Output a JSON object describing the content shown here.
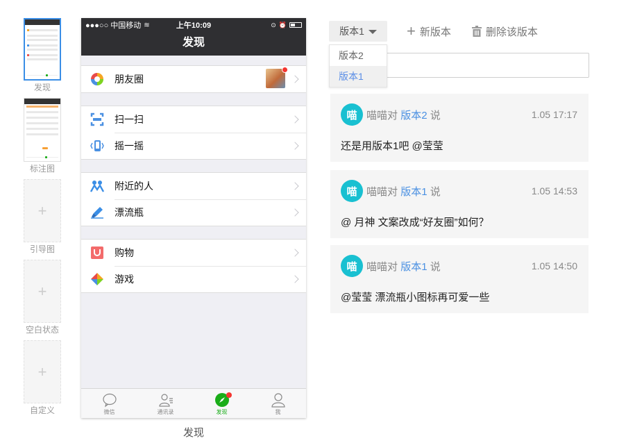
{
  "thumbnails": [
    {
      "caption": "发现",
      "active": true
    },
    {
      "caption": "标注图",
      "active": false
    },
    {
      "caption": "引导图",
      "plus": "+"
    },
    {
      "caption": "空白状态",
      "plus": "+"
    },
    {
      "caption": "自定义",
      "plus": "+"
    }
  ],
  "phone": {
    "status": {
      "carrier": "●●●○○ 中国移动",
      "time": "上午10:09"
    },
    "title": "发现",
    "groups": [
      [
        {
          "label": "朋友圈",
          "icon": "moments-icon"
        }
      ],
      [
        {
          "label": "扫一扫",
          "icon": "scan-icon"
        },
        {
          "label": "摇一摇",
          "icon": "shake-icon"
        }
      ],
      [
        {
          "label": "附近的人",
          "icon": "nearby-people-icon"
        },
        {
          "label": "漂流瓶",
          "icon": "drift-bottle-icon"
        }
      ],
      [
        {
          "label": "购物",
          "icon": "shopping-icon"
        },
        {
          "label": "游戏",
          "icon": "game-icon"
        }
      ]
    ],
    "tabs": [
      {
        "label": "微信",
        "icon": "chat-icon"
      },
      {
        "label": "通讯录",
        "icon": "contacts-icon"
      },
      {
        "label": "发现",
        "icon": "compass-icon",
        "active": true
      },
      {
        "label": "我",
        "icon": "profile-icon"
      }
    ]
  },
  "phone_caption": "发现",
  "toolbar": {
    "version_label": "版本1",
    "new_version": "新版本",
    "delete_version": "删除该版本"
  },
  "version_dropdown": {
    "options": [
      "版本2",
      "版本1"
    ],
    "selected": "版本1"
  },
  "comments": [
    {
      "avatar": "喵",
      "author": "喵喵对",
      "version": "版本2",
      "says": "说",
      "time": "1.05 17:17",
      "text": "还是用版本1吧 @莹莹"
    },
    {
      "avatar": "喵",
      "author": "喵喵对",
      "version": "版本1",
      "says": "说",
      "time": "1.05 14:53",
      "text": "@ 月神 文案改成“好友圈”如何？"
    },
    {
      "avatar": "喵",
      "author": "喵喵对",
      "version": "版本1",
      "says": "说",
      "time": "1.05 14:50",
      "text": "@莹莹 漂流瓶小图标再可爱一些"
    }
  ],
  "colors": {
    "accent": "#4a90e2",
    "avatar_bg": "#19c0d1",
    "wechat_green": "#1aad19",
    "nav_dark": "#2f2f32"
  }
}
